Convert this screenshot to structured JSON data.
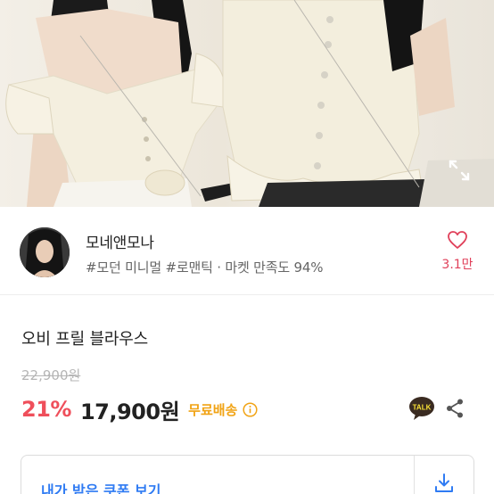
{
  "seller": {
    "name": "모네앤모나",
    "tags": "#모던 미니멀 #로맨틱 · 마켓 만족도 94%",
    "likes": "3.1만"
  },
  "product": {
    "title": "오비 프릴 블라우스",
    "original_price": "22,900원",
    "discount": "21%",
    "price": "17,900원",
    "shipping": "무료배송"
  },
  "coupon": {
    "label": "내가 받은 쿠폰 보기"
  },
  "colors": {
    "discount": "#ef4f5b",
    "shipping": "#f1a314",
    "coupon": "#2f7bf3",
    "like": "#e0405a"
  },
  "icons": {
    "like": "heart-icon",
    "expand": "expand-icon",
    "info": "info-icon",
    "talk": "kakao-talk-icon",
    "share": "share-icon",
    "download": "download-icon"
  }
}
